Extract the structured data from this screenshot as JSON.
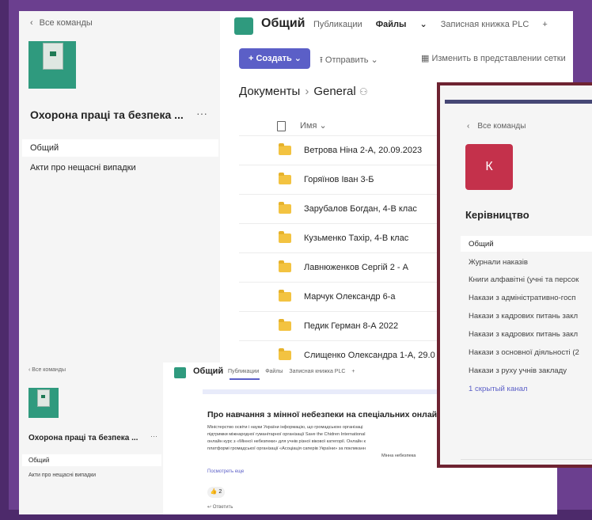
{
  "files_view": {
    "back_label": "Все команды",
    "team_name": "Охорона праці та безпека ...",
    "more": "···",
    "channels": [
      "Общий",
      "Акти про нещасні випадки"
    ],
    "channel_title": "Общий",
    "tabs": [
      "Публикации",
      "Файлы",
      "Записная книжка PLC"
    ],
    "active_tab": "Файлы",
    "add_tab": "+",
    "create_button": "+ Создать",
    "send_button": "Отправить",
    "grid_button": "Изменить в представлении сетки",
    "breadcrumb": [
      "Документы",
      "General"
    ],
    "column_name": "Имя",
    "folders": [
      "Ветрова Ніна 2-А, 20.09.2023",
      "Горяїнов Іван 3-Б",
      "Зарубалов Богдан, 4-В клас",
      "Кузьменко Тахір, 4-В клас",
      "Лавнюженков Сергій 2 - А",
      "Марчук Олександр 6-а",
      "Педик Герман 8-А 2022",
      "Слищенко Олександра 1-А, 29.0"
    ]
  },
  "posts_view": {
    "back_label": "Все команды",
    "team_name": "Охорона праці та безпека ...",
    "more": "···",
    "channels": [
      "Общий",
      "Акти про нещасні випадки"
    ],
    "channel_title": "Общий",
    "tabs": [
      "Публикации",
      "Файлы",
      "Записная книжка PLC",
      "+"
    ],
    "post": {
      "title": "Про навчання з мінної небезпеки на спеціальних онлайн п",
      "body": [
        "Міністерство освіти і науки України інформацію, що громадською організаці",
        "підтримки міжнародної гуманітарної організації Save the Chidren International",
        "онлайн курс з «Мінної небезпеки» для учнів різної вікової категорії. Онлайн к",
        "платформі громадської організації «Асоціація саперів України» за покликанн",
        "Мінна небезпека"
      ],
      "see_more": "Посмотреть еще",
      "reaction": "👍 2",
      "reply": "↩ Ответить"
    }
  },
  "overlay_view": {
    "back_label": "Все команды",
    "team_initial": "К",
    "team_name": "Керівництво",
    "channels": [
      "Общий",
      "Журнали наказів",
      "Книги алфавітні (учні та персок",
      "Накази з адміністративно-госп",
      "Накази з кадрових питань закл",
      "Накази з кадрових питань закл",
      "Накази з основної діяльності (2",
      "Накази з руху учнів закладу"
    ],
    "hidden_channels": "1 скрытый канал"
  },
  "overlay_fragment": "у",
  "colors": {
    "slide_background": "#6b3f8f",
    "teams_purple": "#5b5fc7",
    "frame_maroon": "#6e2331",
    "team_tile_red": "#c4314b",
    "folder_yellow": "#f3c341"
  }
}
